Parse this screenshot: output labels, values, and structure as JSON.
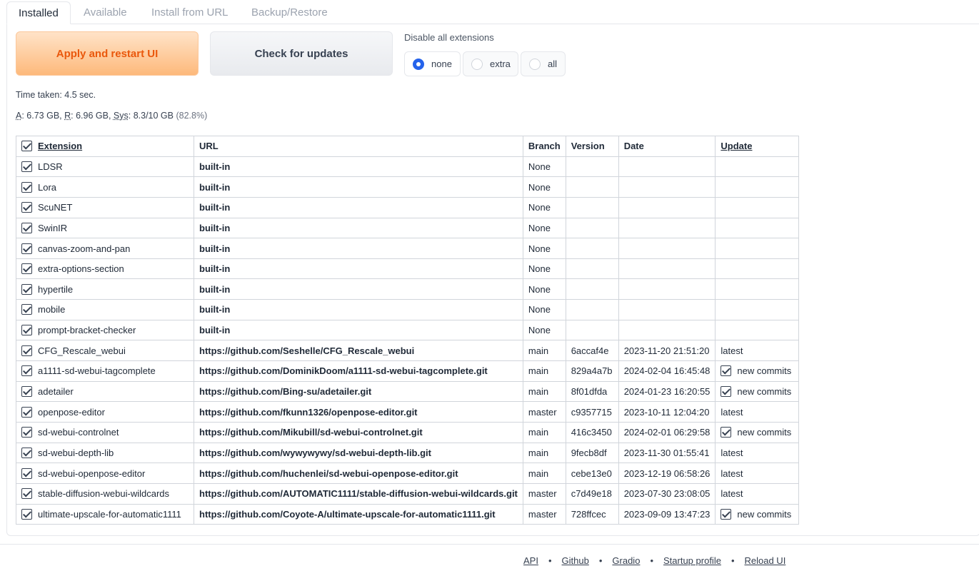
{
  "tabs": [
    {
      "label": "Installed"
    },
    {
      "label": "Available"
    },
    {
      "label": "Install from URL"
    },
    {
      "label": "Backup/Restore"
    }
  ],
  "buttons": {
    "apply": "Apply and restart UI",
    "check": "Check for updates"
  },
  "disable": {
    "label": "Disable all extensions",
    "options": [
      "none",
      "extra",
      "all"
    ],
    "selected": "none"
  },
  "info": {
    "time": "Time taken: 4.5 sec.",
    "a_label": "A",
    "a_value": ": 6.73 GB, ",
    "r_label": "R",
    "r_value": ": 6.96 GB, ",
    "sys_label": "Sys",
    "sys_value": ": 8.3/10 GB ",
    "sys_pct": "(82.8%)"
  },
  "table": {
    "headers": [
      "Extension",
      "URL",
      "Branch",
      "Version",
      "Date",
      "Update"
    ],
    "rows": [
      {
        "name": "LDSR",
        "url": "built-in",
        "branch": "None",
        "version": "",
        "date": "",
        "update": "",
        "new": false
      },
      {
        "name": "Lora",
        "url": "built-in",
        "branch": "None",
        "version": "",
        "date": "",
        "update": "",
        "new": false
      },
      {
        "name": "ScuNET",
        "url": "built-in",
        "branch": "None",
        "version": "",
        "date": "",
        "update": "",
        "new": false
      },
      {
        "name": "SwinIR",
        "url": "built-in",
        "branch": "None",
        "version": "",
        "date": "",
        "update": "",
        "new": false
      },
      {
        "name": "canvas-zoom-and-pan",
        "url": "built-in",
        "branch": "None",
        "version": "",
        "date": "",
        "update": "",
        "new": false
      },
      {
        "name": "extra-options-section",
        "url": "built-in",
        "branch": "None",
        "version": "",
        "date": "",
        "update": "",
        "new": false
      },
      {
        "name": "hypertile",
        "url": "built-in",
        "branch": "None",
        "version": "",
        "date": "",
        "update": "",
        "new": false
      },
      {
        "name": "mobile",
        "url": "built-in",
        "branch": "None",
        "version": "",
        "date": "",
        "update": "",
        "new": false
      },
      {
        "name": "prompt-bracket-checker",
        "url": "built-in",
        "branch": "None",
        "version": "",
        "date": "",
        "update": "",
        "new": false
      },
      {
        "name": "CFG_Rescale_webui",
        "url": "https://github.com/Seshelle/CFG_Rescale_webui",
        "branch": "main",
        "version": "6accaf4e",
        "date": "2023-11-20 21:51:20",
        "update": "latest",
        "new": false
      },
      {
        "name": "a1111-sd-webui-tagcomplete",
        "url": "https://github.com/DominikDoom/a1111-sd-webui-tagcomplete.git",
        "branch": "main",
        "version": "829a4a7b",
        "date": "2024-02-04 16:45:48",
        "update": "new commits",
        "new": true
      },
      {
        "name": "adetailer",
        "url": "https://github.com/Bing-su/adetailer.git",
        "branch": "main",
        "version": "8f01dfda",
        "date": "2024-01-23 16:20:55",
        "update": "new commits",
        "new": true
      },
      {
        "name": "openpose-editor",
        "url": "https://github.com/fkunn1326/openpose-editor.git",
        "branch": "master",
        "version": "c9357715",
        "date": "2023-10-11 12:04:20",
        "update": "latest",
        "new": false
      },
      {
        "name": "sd-webui-controlnet",
        "url": "https://github.com/Mikubill/sd-webui-controlnet.git",
        "branch": "main",
        "version": "416c3450",
        "date": "2024-02-01 06:29:58",
        "update": "new commits",
        "new": true
      },
      {
        "name": "sd-webui-depth-lib",
        "url": "https://github.com/wywywywy/sd-webui-depth-lib.git",
        "branch": "main",
        "version": "9fecb8df",
        "date": "2023-11-30 01:55:41",
        "update": "latest",
        "new": false
      },
      {
        "name": "sd-webui-openpose-editor",
        "url": "https://github.com/huchenlei/sd-webui-openpose-editor.git",
        "branch": "main",
        "version": "cebe13e0",
        "date": "2023-12-19 06:58:26",
        "update": "latest",
        "new": false
      },
      {
        "name": "stable-diffusion-webui-wildcards",
        "url": "https://github.com/AUTOMATIC1111/stable-diffusion-webui-wildcards.git",
        "branch": "master",
        "version": "c7d49e18",
        "date": "2023-07-30 23:08:05",
        "update": "latest",
        "new": false
      },
      {
        "name": "ultimate-upscale-for-automatic1111",
        "url": "https://github.com/Coyote-A/ultimate-upscale-for-automatic1111.git",
        "branch": "master",
        "version": "728ffcec",
        "date": "2023-09-09 13:47:23",
        "update": "new commits",
        "new": true
      }
    ]
  },
  "footer": {
    "links": [
      "API",
      "Github",
      "Gradio",
      "Startup profile",
      "Reload UI"
    ],
    "separator": "•"
  }
}
